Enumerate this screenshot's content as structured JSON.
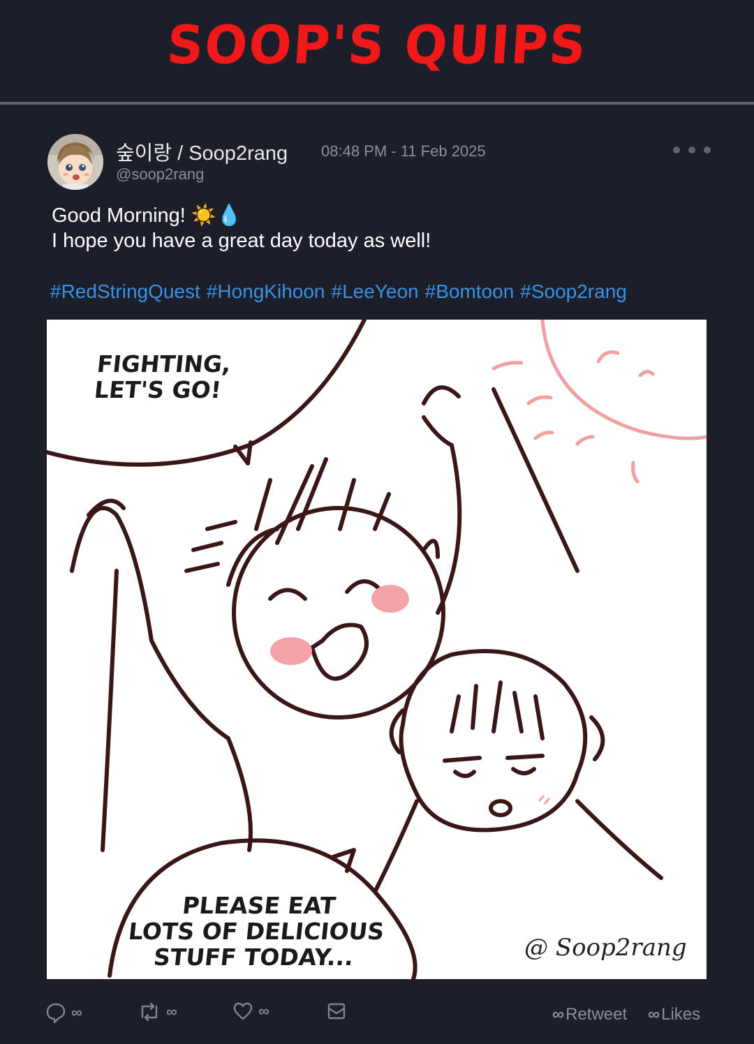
{
  "header": {
    "title": "SOOP'S QUIPS"
  },
  "tweet": {
    "display_name": "숲이랑 / Soop2rang",
    "timestamp": "08:48 PM - 11 Feb 2025",
    "handle": "@soop2rang",
    "text_line1": "Good Morning! ☀️💧",
    "text_line2": "I hope you have a great day today as well!",
    "hashtags": [
      "#RedStringQuest",
      "#HongKihoon",
      "#LeeYeon",
      "#Bomtoon",
      "#Soop2rang"
    ],
    "menu_icon": "more-icon"
  },
  "comic": {
    "bubble_top": "FIGHTING,\nLET'S GO!",
    "bubble_bottom": "PLEASE EAT\nLOTS OF DELICIOUS\nSTUFF TODAY...",
    "watermark": "@ Soop2rang",
    "line_color": "#3a1616",
    "blush_color": "#f5a3a8",
    "sun_color": "#f0a0a0"
  },
  "actions": {
    "reply_count": "∞",
    "retweet_count": "∞",
    "like_count": "∞",
    "retweet_stat_count": "∞",
    "retweet_stat_label": "Retweet",
    "likes_stat_count": "∞",
    "likes_stat_label": "Likes"
  },
  "colors": {
    "background": "#1c1f2a",
    "title_red": "#f01818",
    "hashtag_blue": "#3b92e3",
    "muted_text": "#8b919c"
  }
}
